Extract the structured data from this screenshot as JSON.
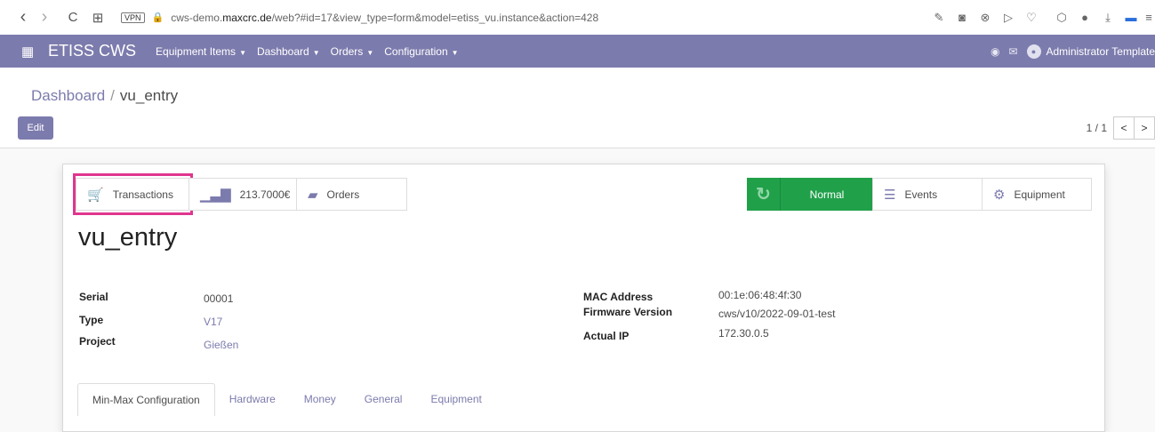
{
  "browser": {
    "back": "‹",
    "forward": "›",
    "reload": "C",
    "grid": "⊞",
    "vpn_label": "VPN",
    "lock": "🔒",
    "url_prefix": "cws-demo.",
    "url_domain": "maxcrc.de",
    "url_suffix": "/web?#id=17&view_type=form&model=etiss_vu.instance&action=428"
  },
  "navbar": {
    "brand": "ETISS CWS",
    "menu": [
      "Equipment Items",
      "Dashboard",
      "Orders",
      "Configuration"
    ],
    "user": "Administrator Template"
  },
  "control_panel": {
    "breadcrumb_parent": "Dashboard",
    "breadcrumb_separator": "/",
    "breadcrumb_current": "vu_entry",
    "edit_label": "Edit",
    "pager_value": "1 / 1"
  },
  "smart_buttons": {
    "transactions": "Transactions",
    "amount": "213.7000€",
    "orders": "Orders",
    "status": "Normal",
    "events": "Events",
    "equipment": "Equipment"
  },
  "record": {
    "title": "vu_entry",
    "left_fields": [
      {
        "label": "Serial",
        "value": "00001"
      },
      {
        "label": "Type",
        "value": "V17"
      },
      {
        "label": "Project",
        "value": "Gießen"
      }
    ],
    "right_fields": [
      {
        "label": "MAC Address",
        "value": "00:1e:06:48:4f:30"
      },
      {
        "label": "Firmware Version",
        "value": "cws/v10/2022-09-01-test"
      },
      {
        "label": "Actual IP",
        "value": "172.30.0.5"
      }
    ]
  },
  "tabs": [
    "Min-Max Configuration",
    "Hardware",
    "Money",
    "General",
    "Equipment"
  ],
  "colors": {
    "accent": "#7c7bad",
    "status_green": "#21a04a",
    "highlight": "#e0368f"
  }
}
